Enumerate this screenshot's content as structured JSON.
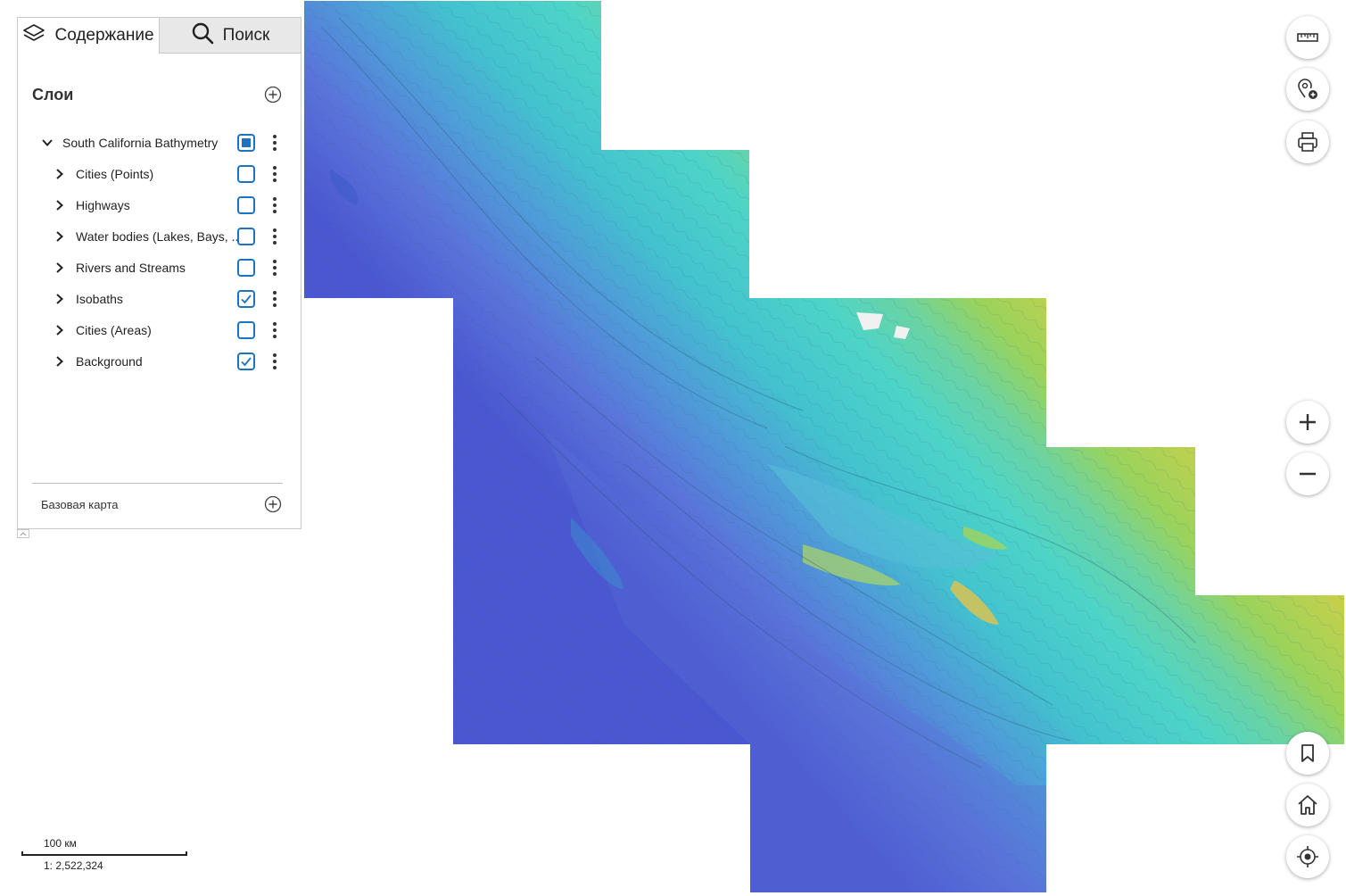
{
  "tabs": {
    "contents_label": "Содержание",
    "search_label": "Поиск"
  },
  "layers_section": {
    "title": "Слои",
    "group": {
      "label": "South California Bathymetry",
      "checkbox_state": "partial",
      "expanded": true
    },
    "items": [
      {
        "label": "Cities (Points)",
        "checked": false
      },
      {
        "label": "Highways",
        "checked": false
      },
      {
        "label": "Water bodies (Lakes, Bays, ...)",
        "checked": false
      },
      {
        "label": "Rivers and Streams",
        "checked": false
      },
      {
        "label": "Isobaths",
        "checked": true
      },
      {
        "label": "Cities (Areas)",
        "checked": false
      },
      {
        "label": "Background",
        "checked": true
      }
    ]
  },
  "basemap": {
    "label": "Базовая карта"
  },
  "scale": {
    "distance": "100 км",
    "ratio": "1: 2,522,324"
  },
  "colors": {
    "accent": "#1e73be",
    "deep_water": "#5563d6",
    "mid_water": "#3fc4cc",
    "shelf": "#4fd6c8",
    "lowland": "#9bd35a",
    "hills": "#e0c04a",
    "mountains": "#c86a30"
  },
  "icons": {
    "contents_tab": "layers-icon",
    "search_tab": "search-icon",
    "measure": "ruler-icon",
    "add_place": "add-location-icon",
    "print": "printer-icon",
    "zoom_in": "plus-icon",
    "zoom_out": "minus-icon",
    "bookmarks": "bookmark-icon",
    "home": "home-icon",
    "locate": "locate-icon"
  }
}
